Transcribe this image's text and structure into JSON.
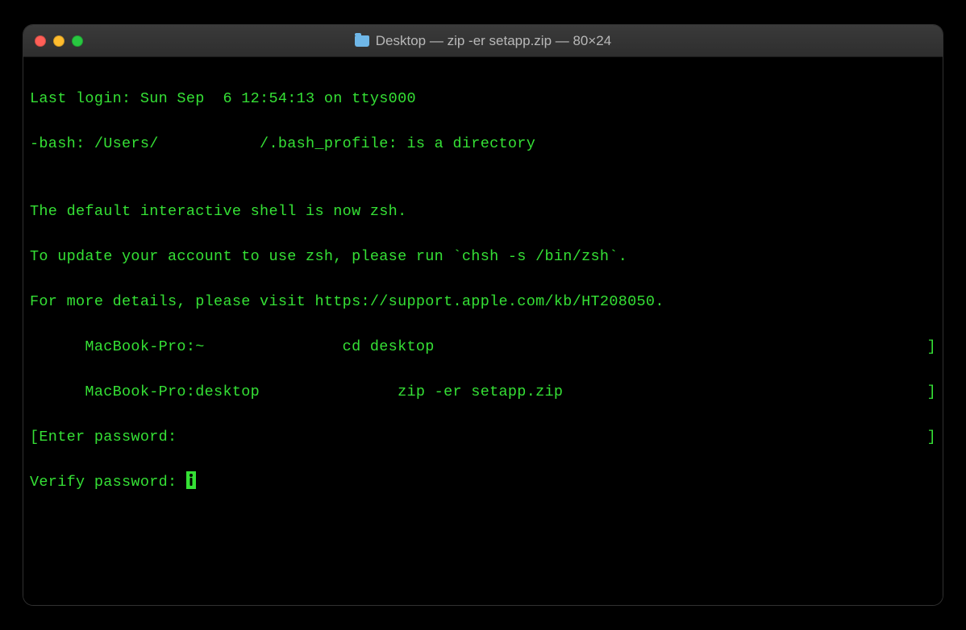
{
  "window": {
    "title": "Desktop — zip -er setapp.zip — 80×24"
  },
  "terminal": {
    "lines": {
      "l0": "Last login: Sun Sep  6 12:54:13 on ttys000",
      "l1": "-bash: /Users/           /.bash_profile: is a directory",
      "l2": "",
      "l3": "The default interactive shell is now zsh.",
      "l4": "To update your account to use zsh, please run `chsh -s /bin/zsh`.",
      "l5": "For more details, please visit https://support.apple.com/kb/HT208050.",
      "l6_left": "      MacBook-Pro:~               cd desktop",
      "l6_right": "]",
      "l7_left": "      MacBook-Pro:desktop               zip -er setapp.zip",
      "l7_right": "]",
      "l8_left": "[Enter password: ",
      "l8_right": "]",
      "l9": "Verify password: "
    }
  }
}
